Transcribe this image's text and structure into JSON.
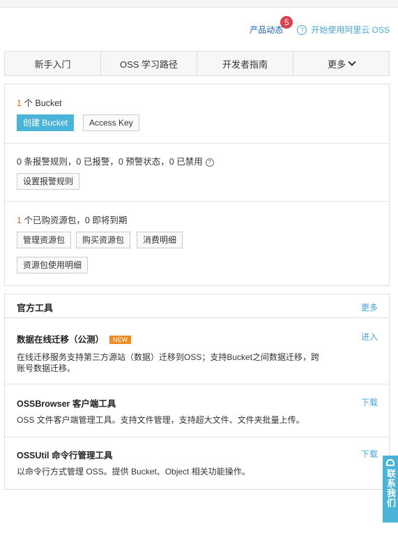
{
  "header": {
    "news_label": "产品动态",
    "news_count": "5",
    "start_label": "开始使用阿里云 OSS"
  },
  "tabs": [
    {
      "label": "新手入门"
    },
    {
      "label": "OSS 学习路径"
    },
    {
      "label": "开发者指南"
    },
    {
      "label": "更多"
    }
  ],
  "bucket": {
    "count": "1",
    "count_suffix": " 个 Bucket",
    "create_label": "创建 Bucket",
    "access_key_label": "Access Key"
  },
  "alarm": {
    "summary": "0 条报警规则，0 已报警，0 预警状态，0 已禁用",
    "settings_label": "设置报警规则"
  },
  "resource": {
    "count": "1",
    "summary_suffix": " 个已购资源包，0 即将到期",
    "manage_label": "管理资源包",
    "buy_label": "购买资源包",
    "billing_label": "消费明细",
    "usage_label": "资源包使用明细"
  },
  "tools": {
    "title": "官方工具",
    "more_label": "更多",
    "items": [
      {
        "name": "数据在线迁移（公测）",
        "badge": "NEW",
        "desc": "在线迁移服务支持第三方源站（数据）迁移到OSS；支持Bucket之间数据迁移，跨账号数据迁移。",
        "action": "进入"
      },
      {
        "name": "OSSBrowser 客户端工具",
        "desc": "OSS 文件客户端管理工具。支持文件管理，支持超大文件、文件夹批量上传。",
        "action": "下载"
      },
      {
        "name": "OSSUtil 命令行管理工具",
        "desc": "以命令行方式管理 OSS。提供 Bucket、Object 相关功能操作。",
        "action": "下载"
      }
    ]
  },
  "contact": {
    "label": "联系我们"
  }
}
